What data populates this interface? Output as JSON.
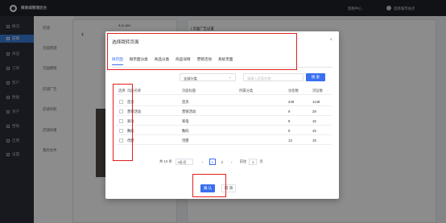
{
  "header": {
    "brand": "微商城管理后台",
    "links": [
      "客服中心",
      "选择城市站点"
    ]
  },
  "sidebar": {
    "items": [
      {
        "label": "概况"
      },
      {
        "label": "店铺"
      },
      {
        "label": "商品"
      },
      {
        "label": "订单"
      },
      {
        "label": "客户"
      },
      {
        "label": "数据"
      },
      {
        "label": "资产"
      },
      {
        "label": "营销"
      },
      {
        "label": "应用"
      },
      {
        "label": "设置"
      }
    ]
  },
  "subnav": {
    "items": [
      {
        "label": "店铺"
      },
      {
        "label": "页面管理"
      },
      {
        "label": "页面模版"
      },
      {
        "label": "店铺广告"
      },
      {
        "label": "店铺导航"
      },
      {
        "label": "店铺风格"
      },
      {
        "label": "我的文件"
      }
    ]
  },
  "background": {
    "phone_time": "9:41 AM",
    "config_title": "| 页面广告设置"
  },
  "modal": {
    "title": "选择跳转页面",
    "close": "×",
    "tabs": [
      "微页面",
      "微页面分类",
      "商品分类",
      "商品详情",
      "营销活动",
      "系统页面"
    ],
    "category_select": "全部分类",
    "search_placeholder": "请输入页面名称",
    "search_button": "搜 索",
    "columns": [
      "选择",
      "页面名称",
      "页面标题",
      "所属分类",
      "访客数",
      "浏览数"
    ],
    "rows": [
      [
        "首页",
        "首页",
        "",
        "249",
        "1148"
      ],
      [
        "营销活动",
        "营销活动",
        "",
        "9",
        "29"
      ],
      [
        "家电",
        "家电",
        "",
        "8",
        "15"
      ],
      [
        "数码",
        "数码",
        "",
        "9",
        "15"
      ],
      [
        "母婴",
        "母婴",
        "",
        "13",
        "19"
      ]
    ],
    "pagination": {
      "total": "共 10 条",
      "page_size": "5条/页",
      "prev": "‹",
      "pages": [
        "1",
        "2"
      ],
      "next": "›",
      "goto_label": "前往",
      "goto_value": "1",
      "goto_unit": "页"
    },
    "confirm": "确 认",
    "cancel": "取 消"
  },
  "colors": {
    "primary": "#3a6ff2",
    "highlight": "#e02020",
    "sidebar_bg": "#2b2f3a",
    "sidebar_active": "#3a7bd5"
  }
}
